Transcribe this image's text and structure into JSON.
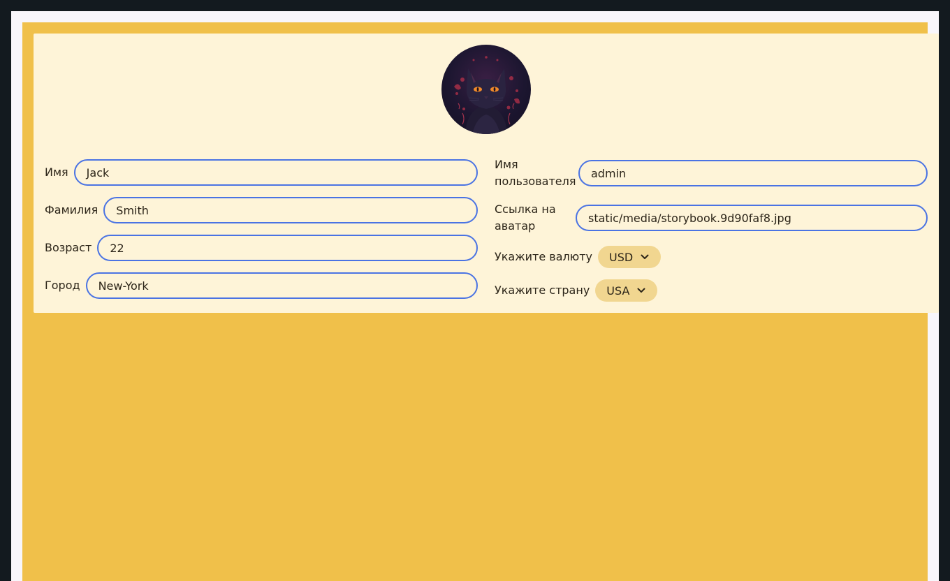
{
  "profile": {
    "avatar_icon": "cat-avatar-icon",
    "fields_left": [
      {
        "label": "Имя",
        "value": "Jack"
      },
      {
        "label": "Фамилия",
        "value": "Smith"
      },
      {
        "label": "Возраст",
        "value": "22"
      },
      {
        "label": "Город",
        "value": "New-York"
      }
    ],
    "fields_right": [
      {
        "label": "Имя пользователя",
        "value": "admin"
      },
      {
        "label": "Ссылка на аватар",
        "value": "static/media/storybook.9d90faf8.jpg"
      }
    ],
    "currency": {
      "label": "Укажите валюту",
      "value": "USD"
    },
    "country": {
      "label": "Укажите страну",
      "value": "USA"
    }
  },
  "colors": {
    "frame": "#131a1f",
    "page": "#f0c04a",
    "card": "#fef4d8",
    "input_border": "#4a73e3",
    "select_bg": "#f1d690"
  }
}
